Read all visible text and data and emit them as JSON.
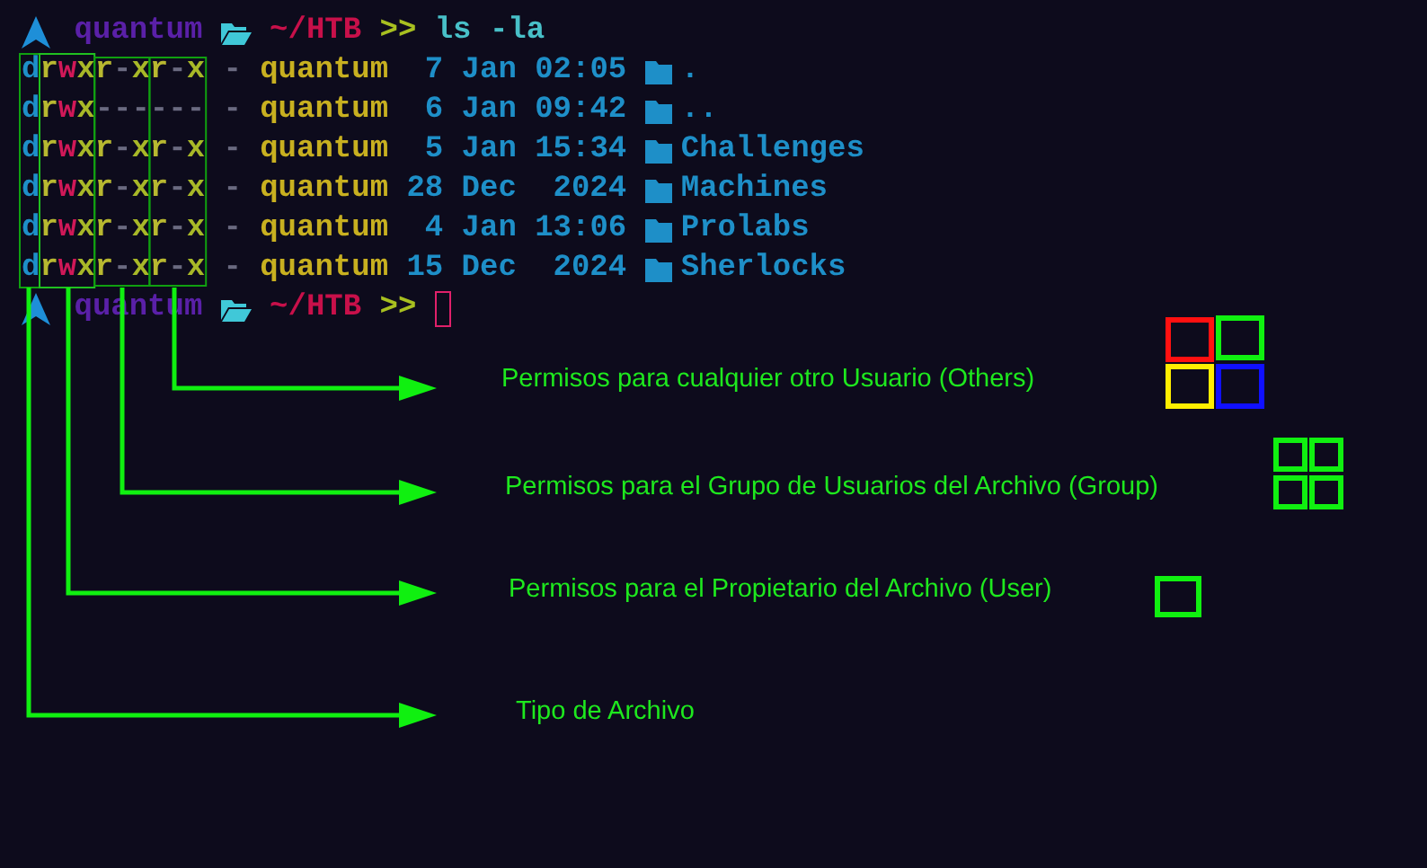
{
  "prompt": {
    "user": "quantum",
    "path": "~/HTB",
    "arrows": ">>",
    "command": "ls -la"
  },
  "listing": [
    {
      "permissions": "drwxr-xr-x",
      "links": "-",
      "owner": "quantum",
      "day": "7",
      "month": "Jan",
      "time": "02:05",
      "name": "."
    },
    {
      "permissions": "drwx------",
      "links": "-",
      "owner": "quantum",
      "day": "6",
      "month": "Jan",
      "time": "09:42",
      "name": ".."
    },
    {
      "permissions": "drwxr-xr-x",
      "links": "-",
      "owner": "quantum",
      "day": "5",
      "month": "Jan",
      "time": "15:34",
      "name": "Challenges"
    },
    {
      "permissions": "drwxr-xr-x",
      "links": "-",
      "owner": "quantum",
      "day": "28",
      "month": "Dec",
      "time": "2024",
      "name": "Machines"
    },
    {
      "permissions": "drwxr-xr-x",
      "links": "-",
      "owner": "quantum",
      "day": "4",
      "month": "Jan",
      "time": "13:06",
      "name": "Prolabs"
    },
    {
      "permissions": "drwxr-xr-x",
      "links": "-",
      "owner": "quantum",
      "day": "15",
      "month": "Dec",
      "time": "2024",
      "name": "Sherlocks"
    }
  ],
  "prompt_2": {
    "user": "quantum",
    "path": "~/HTB",
    "arrows": ">>"
  },
  "annotations": [
    {
      "kind": "others",
      "label": "Permisos para cualquier otro Usuario (Others)"
    },
    {
      "kind": "group",
      "label": "Permisos para el Grupo de Usuarios del Archivo (Group)"
    },
    {
      "kind": "user",
      "label": "Permisos para el Propietario del Archivo (User)"
    },
    {
      "kind": "type",
      "label": "Tipo de Archivo"
    }
  ]
}
